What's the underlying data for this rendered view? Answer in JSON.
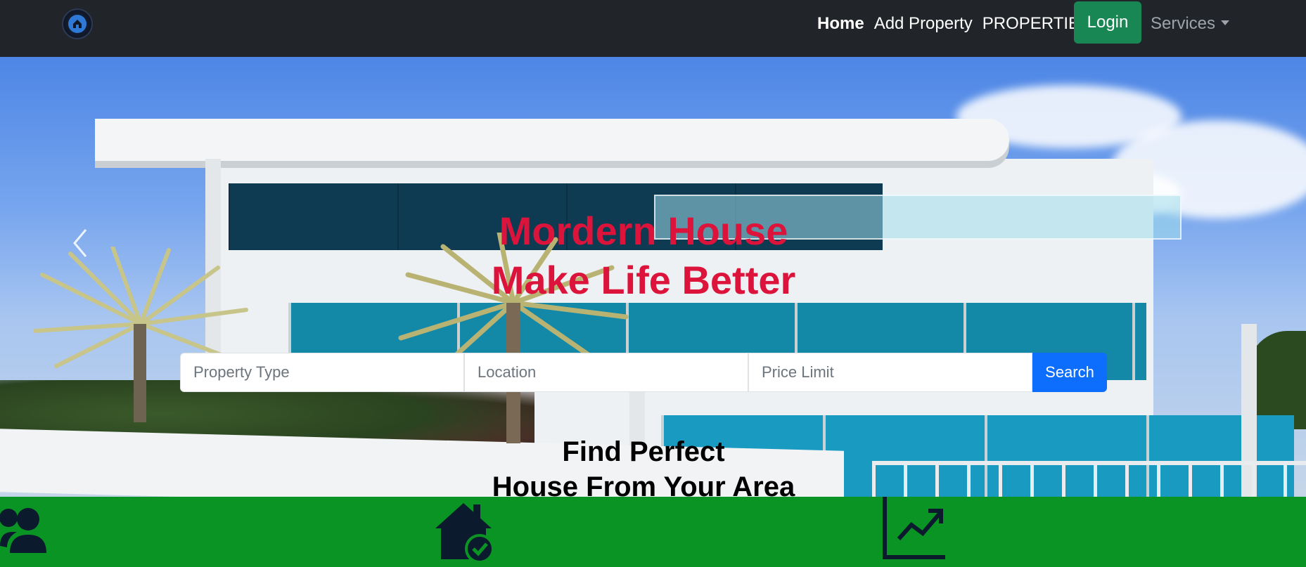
{
  "navbar": {
    "logo_icon": "real-estate-logo-icon",
    "links": [
      {
        "label": "Home",
        "active": true
      },
      {
        "label": "Add Property",
        "active": false
      },
      {
        "label": "PROPERTIES",
        "active": false
      }
    ],
    "login_label": "Login",
    "services_label": "Services"
  },
  "hero": {
    "title_line1": "Mordern House",
    "title_line2": "Make Life Better",
    "title_color": "#dc143c",
    "search": {
      "property_type_placeholder": "Property Type",
      "location_placeholder": "Location",
      "price_limit_placeholder": "Price Limit",
      "button_label": "Search"
    },
    "subtitle_line1": "Find Perfect",
    "subtitle_line2": "House From Your Area"
  },
  "features": {
    "background": "#0a9423",
    "icons": [
      "users-icon",
      "house-check-icon",
      "chart-line-icon"
    ]
  },
  "colors": {
    "navbar_bg": "#212529",
    "login_bg": "#198754",
    "search_button_bg": "#0d6efd"
  }
}
